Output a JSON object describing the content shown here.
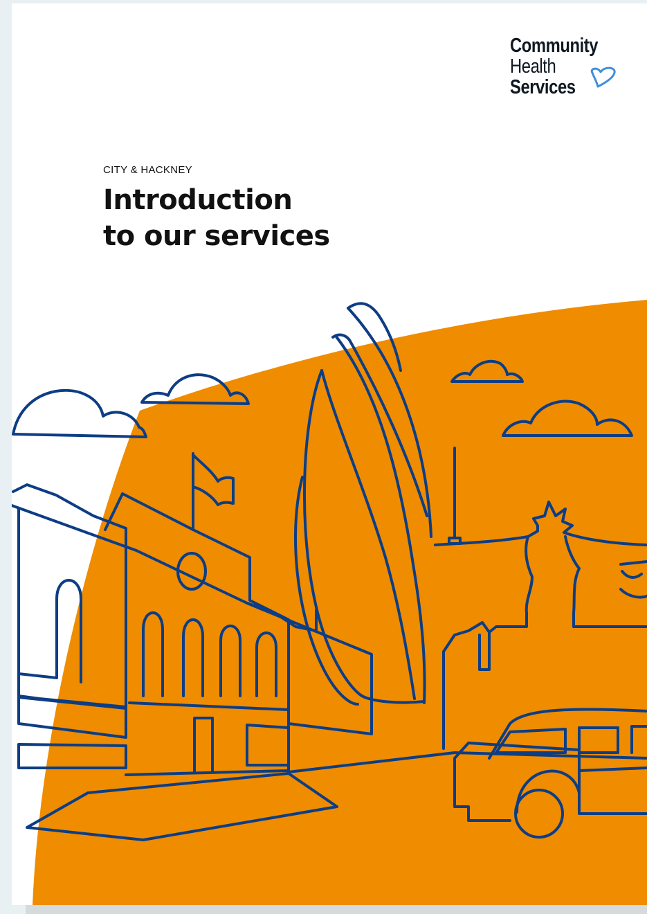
{
  "logo": {
    "line1": "Community",
    "line2": "Health",
    "line3": "Services",
    "icon": "heart-icon",
    "heart_color": "#3f8fd9"
  },
  "cover": {
    "eyebrow": "CITY & HACKNEY",
    "title_line1": "Introduction",
    "title_line2": "to our services"
  },
  "illustration": {
    "subject": "London skyline line art",
    "fill_color": "#ef8c00",
    "line_color": "#0d3d84"
  }
}
